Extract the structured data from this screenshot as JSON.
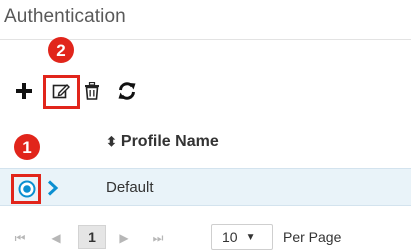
{
  "page": {
    "title": "Authentication"
  },
  "annotations": {
    "badge_1": "1",
    "badge_2": "2"
  },
  "colors": {
    "highlight": "#e1251b",
    "accent": "#0a8fd1",
    "row_selected": "#e9f3f9"
  },
  "toolbar": {
    "items": [
      {
        "icon": "plus-icon"
      },
      {
        "icon": "edit-icon"
      },
      {
        "icon": "trash-icon"
      },
      {
        "icon": "refresh-icon"
      }
    ]
  },
  "table": {
    "columns": [
      {
        "label": "Profile Name",
        "sort_icon": "sort-icon"
      }
    ],
    "rows": [
      {
        "name": "Default",
        "selected": true
      }
    ]
  },
  "pagination": {
    "current_page": "1",
    "per_page": "10",
    "per_page_label": "Per Page"
  }
}
